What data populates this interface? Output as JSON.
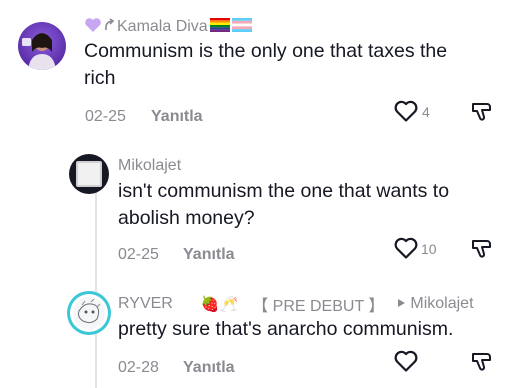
{
  "comments": [
    {
      "username": "Kamala Diva",
      "text_line1": "Communism is the only one that taxes the",
      "text_line2": "rich",
      "date": "02-25",
      "reply_label": "Yanıtla",
      "likes": "4"
    },
    {
      "username": "Mikolajet",
      "text_line1": "isn't communism the one that wants to",
      "text_line2": "abolish money?",
      "date": "02-25",
      "reply_label": "Yanıtla",
      "likes": "10"
    },
    {
      "username": "RYVER",
      "emoji": "🍓🥂",
      "tag": "【 PRE DEBUT 】",
      "reply_to": "Mikolajet",
      "text_line1": "pretty sure that's anarcho communism.",
      "date": "02-28",
      "reply_label": "Yanıtla",
      "likes": ""
    }
  ],
  "icons": {
    "like": "heart-outline-icon",
    "dislike": "thumbs-down-icon",
    "reply_arrow": "play-triangle-icon"
  },
  "colors": {
    "primary_text": "#161823",
    "secondary_text": "#8a8b91",
    "avatar1_bg": "#6a3fb8",
    "avatar3_ring": "#3cc7d6"
  }
}
